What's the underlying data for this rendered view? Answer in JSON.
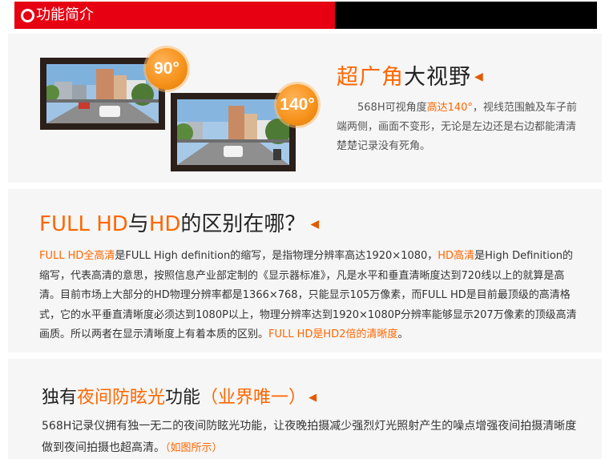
{
  "header": {
    "title": "功能简介",
    "colors": {
      "red": "#e60012",
      "black": "#000000"
    },
    "icon": "ring-icon"
  },
  "wide_angle": {
    "title_orange": "超广角",
    "title_black": "大视野",
    "arrow": "◀",
    "badge_small": "90°",
    "badge_large": "140°",
    "body_prefix": "568H可视角度",
    "body_highlight": "高达140°",
    "body_suffix": "，视线范围触及车子前端两侧，画面不变形，无论是左边还是右边都能清清楚楚记录没有死角。"
  },
  "full_hd": {
    "title_1": "FULL HD",
    "title_2": "与",
    "title_3": "HD",
    "title_4": "的区别在哪？",
    "arrow": "◀",
    "p_hl1": "FULL HD全高清",
    "p_1": "是FULL High definition的缩写，是指物理分辨率高达1920×1080，",
    "p_hl2": "HD高清",
    "p_2": "是High Definition的缩写，代表高清的意思，按照信息产业部定制的《显示器标准》，凡是水平和垂直清晰度达到720线以上的就算是高清。目前市场上大部分的HD物理分辨率都是1366×768，只能显示105万像素，而FULL HD是目前最顶级的高清格式，它的水平垂直清晰度必须达到1080P以上，物理分辨率达到1920×1080P分辨率能够显示207万像素的顶级高清画质。所以两者在显示清晰度上有着本质的区别。",
    "p_hl3": "FULL HD是HD2倍的清晰度",
    "p_end": "。"
  },
  "night": {
    "title_1": "独有",
    "title_2": "夜间防眩光",
    "title_3": "功能",
    "title_4": "（业界唯一）",
    "arrow": "◀",
    "body": "568H记录仪拥有独一无二的夜间防眩光功能，让夜晚拍摄减少强烈灯光照射产生的噪点增强夜间拍摄清晰度做到夜间拍摄也超高清。",
    "note": "（如图所示）"
  },
  "accent_color": "#ff6600"
}
